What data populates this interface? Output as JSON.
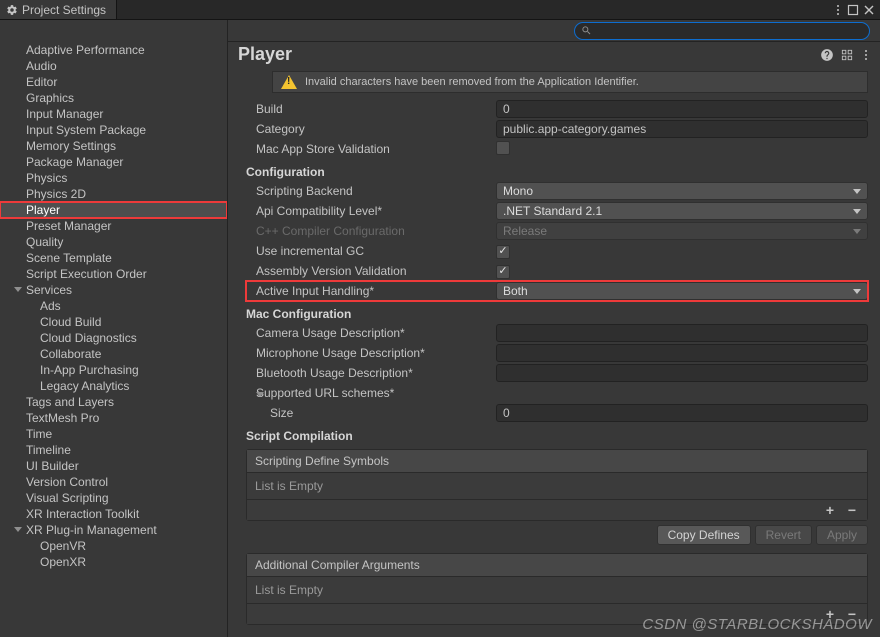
{
  "window": {
    "tab_title": "Project Settings"
  },
  "search": {
    "placeholder": ""
  },
  "sidebar": {
    "items": [
      {
        "label": "Adaptive Performance",
        "indent": false
      },
      {
        "label": "Audio",
        "indent": false
      },
      {
        "label": "Editor",
        "indent": false
      },
      {
        "label": "Graphics",
        "indent": false
      },
      {
        "label": "Input Manager",
        "indent": false
      },
      {
        "label": "Input System Package",
        "indent": false
      },
      {
        "label": "Memory Settings",
        "indent": false
      },
      {
        "label": "Package Manager",
        "indent": false
      },
      {
        "label": "Physics",
        "indent": false
      },
      {
        "label": "Physics 2D",
        "indent": false
      },
      {
        "label": "Player",
        "indent": false,
        "selected": true
      },
      {
        "label": "Preset Manager",
        "indent": false
      },
      {
        "label": "Quality",
        "indent": false
      },
      {
        "label": "Scene Template",
        "indent": false
      },
      {
        "label": "Script Execution Order",
        "indent": false
      },
      {
        "label": "Services",
        "indent": false,
        "caret": true
      },
      {
        "label": "Ads",
        "indent": true
      },
      {
        "label": "Cloud Build",
        "indent": true
      },
      {
        "label": "Cloud Diagnostics",
        "indent": true
      },
      {
        "label": "Collaborate",
        "indent": true
      },
      {
        "label": "In-App Purchasing",
        "indent": true
      },
      {
        "label": "Legacy Analytics",
        "indent": true
      },
      {
        "label": "Tags and Layers",
        "indent": false
      },
      {
        "label": "TextMesh Pro",
        "indent": false
      },
      {
        "label": "Time",
        "indent": false
      },
      {
        "label": "Timeline",
        "indent": false
      },
      {
        "label": "UI Builder",
        "indent": false
      },
      {
        "label": "Version Control",
        "indent": false
      },
      {
        "label": "Visual Scripting",
        "indent": false
      },
      {
        "label": "XR Interaction Toolkit",
        "indent": false
      },
      {
        "label": "XR Plug-in Management",
        "indent": false,
        "caret": true
      },
      {
        "label": "OpenVR",
        "indent": true
      },
      {
        "label": "OpenXR",
        "indent": true
      }
    ]
  },
  "panel": {
    "title": "Player",
    "warning": "Invalid characters have been removed from the Application Identifier.",
    "sections": {
      "identification": {
        "build": {
          "label": "Build",
          "value": "0"
        },
        "category": {
          "label": "Category",
          "value": "public.app-category.games"
        },
        "mac_app_store": {
          "label": "Mac App Store Validation",
          "checked": false
        }
      },
      "configuration": {
        "title": "Configuration",
        "scripting_backend": {
          "label": "Scripting Backend",
          "value": "Mono"
        },
        "api_compat": {
          "label": "Api Compatibility Level*",
          "value": ".NET Standard 2.1"
        },
        "cpp_compiler": {
          "label": "C++ Compiler Configuration",
          "value": "Release"
        },
        "incremental_gc": {
          "label": "Use incremental GC",
          "checked": true
        },
        "assembly_validation": {
          "label": "Assembly Version Validation",
          "checked": true
        },
        "active_input": {
          "label": "Active Input Handling*",
          "value": "Both"
        }
      },
      "mac_config": {
        "title": "Mac Configuration",
        "camera": {
          "label": "Camera Usage Description*",
          "value": ""
        },
        "microphone": {
          "label": "Microphone Usage Description*",
          "value": ""
        },
        "bluetooth": {
          "label": "Bluetooth Usage Description*",
          "value": ""
        },
        "url_schemes": {
          "label": "Supported URL schemes*"
        },
        "size": {
          "label": "Size",
          "value": "0"
        }
      },
      "script_compilation": {
        "title": "Script Compilation",
        "define_symbols": {
          "title": "Scripting Define Symbols",
          "empty": "List is Empty"
        },
        "copy_defines": "Copy Defines",
        "revert": "Revert",
        "apply": "Apply",
        "compiler_args": {
          "title": "Additional Compiler Arguments",
          "empty": "List is Empty"
        }
      }
    }
  },
  "watermark": "CSDN @STARBLOCKSHADOW"
}
